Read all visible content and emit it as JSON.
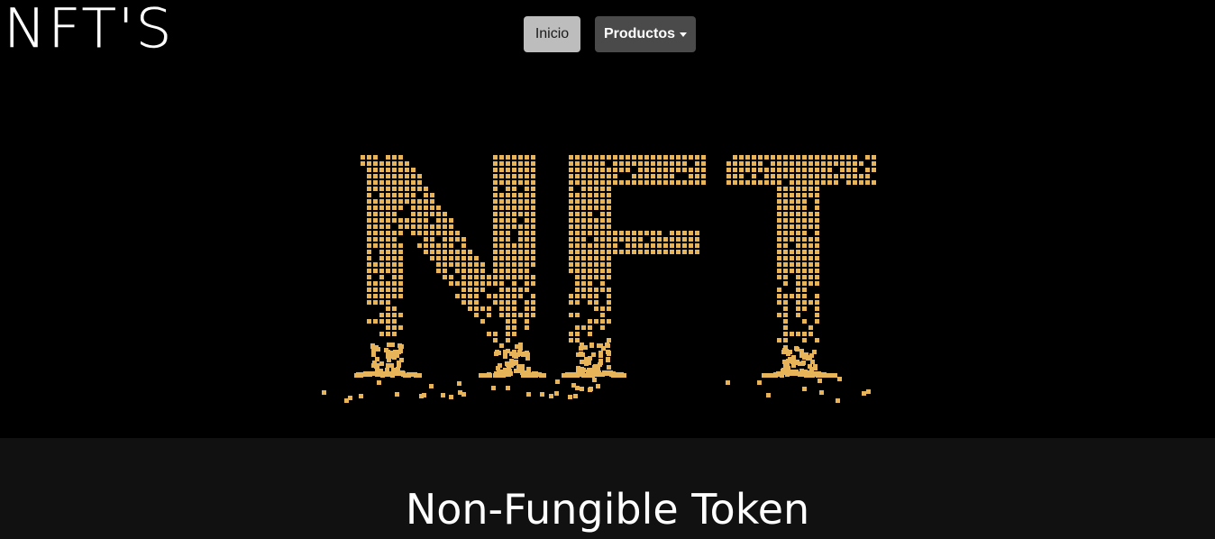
{
  "header": {
    "logo_text": "NFT'S",
    "nav": {
      "home_label": "Inicio",
      "products_label": "Productos"
    }
  },
  "hero": {
    "text": "NFT",
    "dot_color": "#e8b45a",
    "background": "#000000"
  },
  "section": {
    "title": "Non-Fungible Token",
    "background": "#111111"
  }
}
